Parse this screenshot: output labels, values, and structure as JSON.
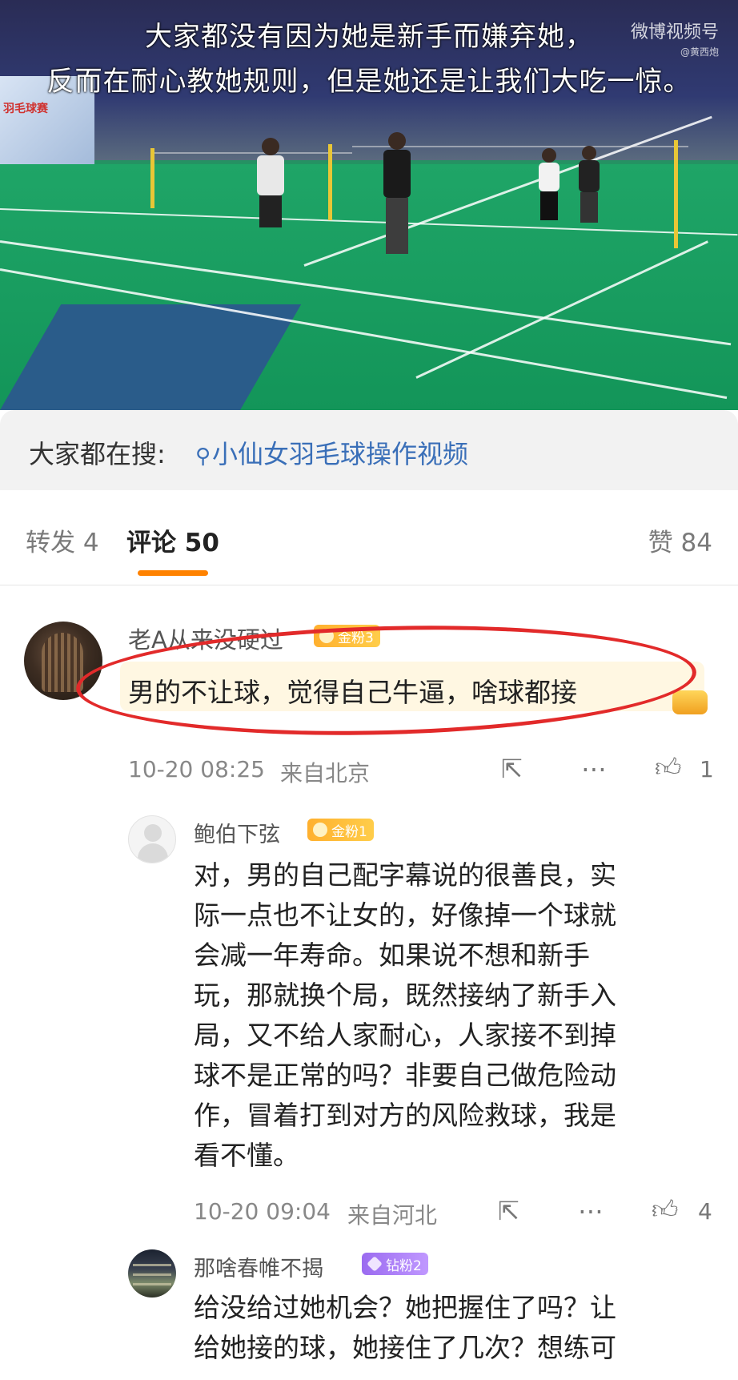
{
  "video": {
    "subtitle_line1": "大家都没有因为她是新手而嫌弃她，",
    "subtitle_line2": "反而在耐心教她规则，但是她还是让我们大吃一惊。",
    "watermark": "微博视频号",
    "watermark_sub": "@黄西炮",
    "banner_text": "羽毛球赛"
  },
  "search": {
    "label": "大家都在搜:",
    "query": "小仙女羽毛球操作视频",
    "icon": "search-icon"
  },
  "tabs": {
    "repost": "转发 4",
    "comments": "评论 50",
    "likes": "赞 84"
  },
  "comment": {
    "username": "老A从来没硬过",
    "badge": "金粉3",
    "text": "男的不让球，觉得自己牛逼，啥球都接",
    "time": "10-20 08:25",
    "location": "来自北京",
    "like_count": "1"
  },
  "replies": [
    {
      "username": "鲍伯下弦",
      "badge": "金粉1",
      "lines": [
        "对，男的自己配字幕说的很善良，实",
        "际一点也不让女的，好像掉一个球就",
        "会减一年寿命。如果说不想和新手",
        "玩，那就换个局，既然接纳了新手入",
        "局，又不给人家耐心，人家接不到掉",
        "球不是正常的吗？非要自己做危险动",
        "作，冒着打到对方的风险救球，我是",
        "看不懂。"
      ],
      "time": "10-20 09:04",
      "location": "来自河北",
      "like_count": "4"
    },
    {
      "username": "那啥春帷不揭",
      "badge": "钻粉2",
      "lines": [
        "给没给过她机会？她把握住了吗？让",
        "给她接的球，她接住了几次？想练可"
      ]
    }
  ],
  "colors": {
    "accent_orange": "#ff8200",
    "link_blue": "#3a6fb8",
    "annotation_red": "#e22a2a"
  }
}
